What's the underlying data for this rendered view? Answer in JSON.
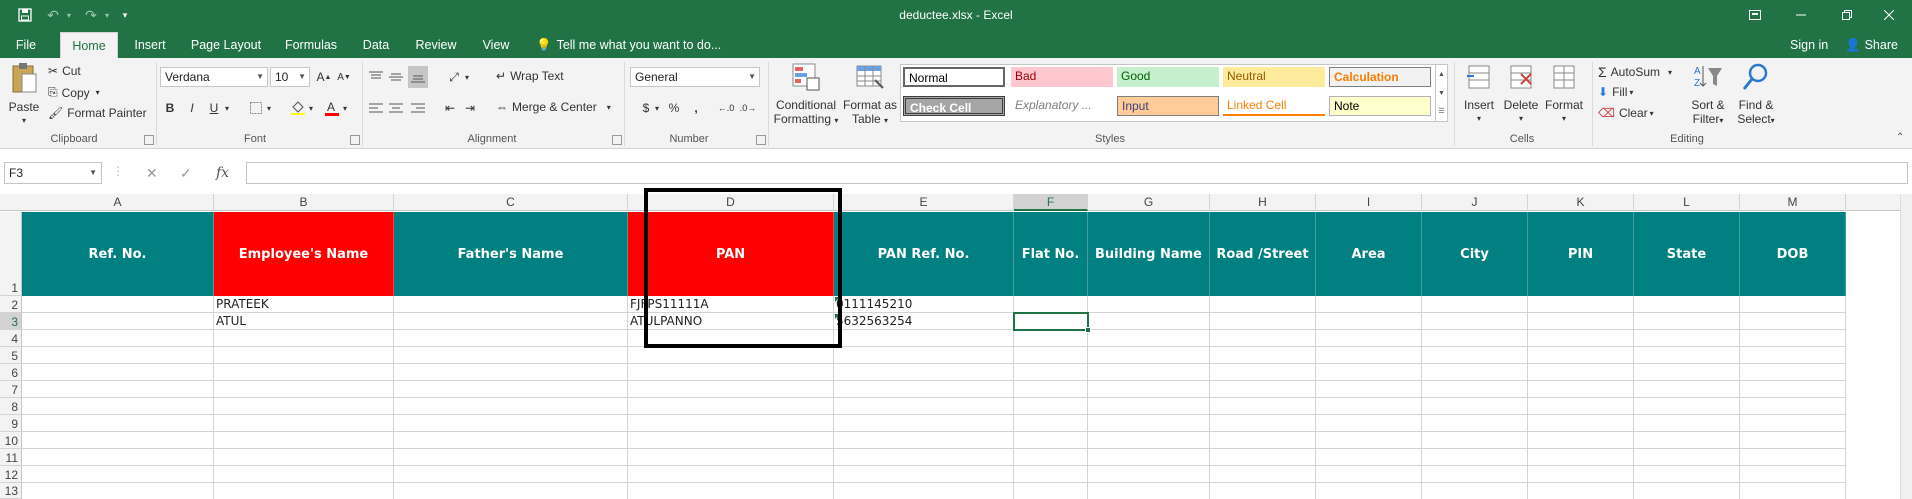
{
  "window": {
    "title": "deductee.xlsx - Excel"
  },
  "tabs": [
    {
      "label": "File"
    },
    {
      "label": "Home"
    },
    {
      "label": "Insert"
    },
    {
      "label": "Page Layout"
    },
    {
      "label": "Formulas"
    },
    {
      "label": "Data"
    },
    {
      "label": "Review"
    },
    {
      "label": "View"
    }
  ],
  "tell_me": "Tell me what you want to do...",
  "account": {
    "signin": "Sign in",
    "share": "Share"
  },
  "ribbon": {
    "clipboard": {
      "paste": "Paste",
      "cut": "Cut",
      "copy": "Copy",
      "format_painter": "Format Painter",
      "label": "Clipboard"
    },
    "font": {
      "name": "Verdana",
      "size": "10",
      "bold": "B",
      "italic": "I",
      "underline": "U",
      "label": "Font"
    },
    "alignment": {
      "wrap": "Wrap Text",
      "merge": "Merge & Center",
      "label": "Alignment"
    },
    "number": {
      "format": "General",
      "currency": "$",
      "percent": "%",
      "comma": ",",
      "label": "Number"
    },
    "styles": {
      "conditional": [
        "Conditional",
        "Formatting"
      ],
      "format_table": [
        "Format as",
        "Table"
      ],
      "cells": [
        "Normal",
        "Bad",
        "Good",
        "Neutral",
        "Calculation",
        "Check Cell",
        "Explanatory ...",
        "Input",
        "Linked Cell",
        "Note"
      ],
      "label": "Styles"
    },
    "cells": {
      "insert": "Insert",
      "delete": "Delete",
      "format": "Format",
      "label": "Cells"
    },
    "editing": {
      "autosum": "AutoSum",
      "fill": "Fill",
      "clear": "Clear",
      "sort": [
        "Sort &",
        "Filter"
      ],
      "find": [
        "Find &",
        "Select"
      ],
      "label": "Editing"
    }
  },
  "formula_bar": {
    "name_box": "F3",
    "cancel": "✕",
    "enter": "✓",
    "fx": "fx",
    "content": ""
  },
  "sheet": {
    "columns": [
      "A",
      "B",
      "C",
      "D",
      "E",
      "F",
      "G",
      "H",
      "I",
      "J",
      "K",
      "L",
      "M"
    ],
    "selected_column": "F",
    "rows": [
      "1",
      "2",
      "3",
      "4",
      "5",
      "6",
      "7",
      "8",
      "9",
      "10",
      "11",
      "12",
      "13"
    ],
    "selected_row": "3",
    "header_row": [
      "Ref. No.",
      "Employee's Name",
      "Father's Name",
      "PAN",
      "PAN Ref. No.",
      "Flat No.",
      "Building Name",
      "Road /Street",
      "Area",
      "City",
      "PIN",
      "State",
      "DOB"
    ],
    "header_colors": [
      "#008080",
      "#ff0000",
      "#008080",
      "#ff0000",
      "#008080",
      "#008080",
      "#008080",
      "#008080",
      "#008080",
      "#008080",
      "#008080",
      "#008080",
      "#008080"
    ],
    "data_rows": [
      [
        "",
        "PRATEEK",
        "",
        "FJFPS11111A",
        "0111145210",
        "",
        "",
        "",
        "",
        "",
        "",
        "",
        ""
      ],
      [
        "",
        "ATUL",
        "",
        "ATULPANNO",
        "5632563254",
        "",
        "",
        "",
        "",
        "",
        "",
        "",
        ""
      ]
    ],
    "active_cell": "F3"
  },
  "colors": {
    "excel_green": "#217346",
    "teal": "#008080",
    "red": "#ff0000"
  }
}
